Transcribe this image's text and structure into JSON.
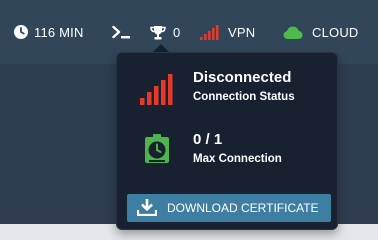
{
  "colors": {
    "topbar_bg": "#32465a",
    "popup_bg": "#17212f",
    "signal_red": "#e53a2a",
    "cloud_green": "#4cbb4c",
    "timer_green": "#4fb34e",
    "button_blue": "#3f7ea3"
  },
  "topbar": {
    "time": {
      "icon": "clock-icon",
      "label": "116 MIN"
    },
    "terminal": {
      "icon": "terminal-icon"
    },
    "trophy": {
      "icon": "trophy-icon",
      "label": "0"
    },
    "vpn": {
      "icon": "signal-bars-icon",
      "label": "VPN"
    },
    "cloud": {
      "icon": "cloud-icon",
      "label": "CLOUD"
    }
  },
  "vpn_popup": {
    "status": {
      "icon": "signal-bars-icon",
      "value": "Disconnected",
      "label": "Connection Status"
    },
    "connections": {
      "icon": "stopwatch-icon",
      "value": "0 / 1",
      "label": "Max Connection"
    },
    "download_button": {
      "icon": "download-icon",
      "label": "DOWNLOAD CERTIFICATE"
    }
  }
}
